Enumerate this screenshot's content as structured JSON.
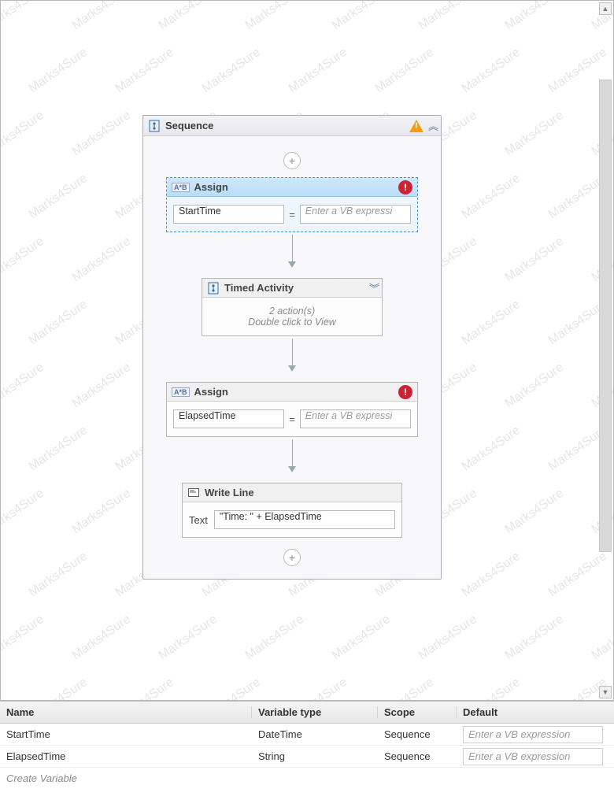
{
  "watermark": "Marks4Sure",
  "sequence": {
    "title": "Sequence",
    "assign1": {
      "label": "Assign",
      "var": "StartTime",
      "expr_placeholder": "Enter a VB expressi"
    },
    "timed": {
      "label": "Timed Activity",
      "line1": "2 action(s)",
      "line2": "Double click to View"
    },
    "assign2": {
      "label": "Assign",
      "var": "ElapsedTime",
      "expr_placeholder": "Enter a VB expressi"
    },
    "writeline": {
      "label": "Write Line",
      "textlabel": "Text",
      "value": "\"Time: \" + ElapsedTime"
    }
  },
  "variables": {
    "headers": {
      "name": "Name",
      "type": "Variable type",
      "scope": "Scope",
      "default": "Default"
    },
    "rows": [
      {
        "name": "StartTime",
        "type": "DateTime",
        "scope": "Sequence",
        "default": "Enter a VB expression"
      },
      {
        "name": "ElapsedTime",
        "type": "String",
        "scope": "Sequence",
        "default": "Enter a VB expression"
      }
    ],
    "create": "Create Variable"
  }
}
